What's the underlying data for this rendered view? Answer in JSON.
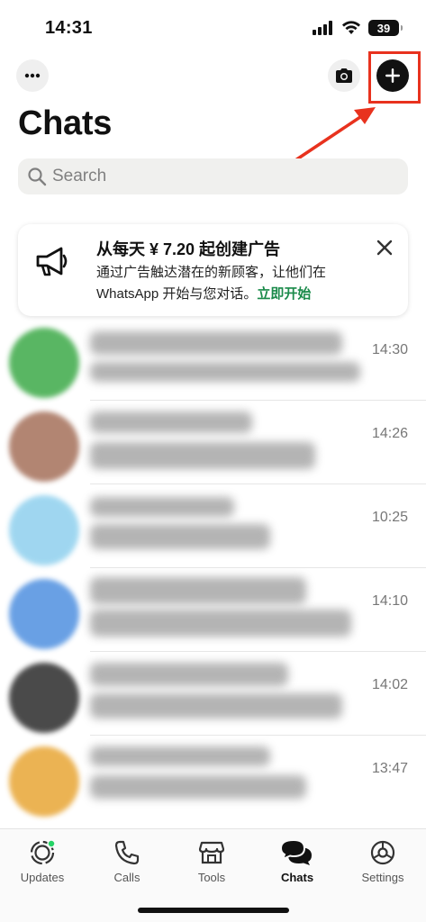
{
  "status_bar": {
    "time": "14:31",
    "battery": "39"
  },
  "header": {
    "title": "Chats",
    "more_icon": "ellipsis-icon",
    "camera_icon": "camera-icon",
    "new_chat_icon": "plus-icon"
  },
  "search": {
    "placeholder": "Search"
  },
  "ad_banner": {
    "title": "从每天 ¥ 7.20 起创建广告",
    "body": "通过广告触达潜在的新顾客，让他们在 WhatsApp 开始与您对话。",
    "link": "立即开始"
  },
  "chats": [
    {
      "time": "14:30",
      "avatar_color": "#3daa48"
    },
    {
      "time": "14:26",
      "avatar_color": "#a5705a"
    },
    {
      "time": "10:25",
      "avatar_color": "#8fd0ee"
    },
    {
      "time": "14:10",
      "avatar_color": "#4f90e0"
    },
    {
      "time": "14:02",
      "avatar_color": "#2b2b2b"
    },
    {
      "time": "13:47",
      "avatar_color": "#e8a636"
    }
  ],
  "tabs": [
    {
      "label": "Updates",
      "icon": "updates-icon",
      "active": false
    },
    {
      "label": "Calls",
      "icon": "phone-icon",
      "active": false
    },
    {
      "label": "Tools",
      "icon": "storefront-icon",
      "active": false
    },
    {
      "label": "Chats",
      "icon": "chat-bubbles-icon",
      "active": true
    },
    {
      "label": "Settings",
      "icon": "gear-icon",
      "active": false
    }
  ],
  "colors": {
    "annotation_red": "#e8321e",
    "link_green": "#1a8a4a",
    "update_dot": "#25d366"
  }
}
